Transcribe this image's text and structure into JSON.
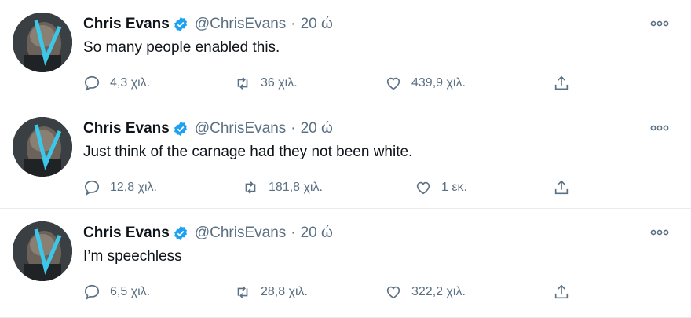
{
  "tweets": [
    {
      "name": "Chris Evans",
      "handle": "@ChrisEvans",
      "separator": "·",
      "time": "20 ώ",
      "text": "So many people enabled this.",
      "replies": "4,3 χιλ.",
      "retweets": "36 χιλ.",
      "likes": "439,9 χιλ."
    },
    {
      "name": "Chris Evans",
      "handle": "@ChrisEvans",
      "separator": "·",
      "time": "20 ώ",
      "text": "Just think of the carnage had they not been white.",
      "replies": "12,8 χιλ.",
      "retweets": "181,8 χιλ.",
      "likes": "1 εκ."
    },
    {
      "name": "Chris Evans",
      "handle": "@ChrisEvans",
      "separator": "·",
      "time": "20 ώ",
      "text": "I’m speechless",
      "replies": "6,5 χιλ.",
      "retweets": "28,8 χιλ.",
      "likes": "322,2 χιλ."
    }
  ],
  "icons": {
    "verified": "verified-badge-icon",
    "more": "more-options-icon",
    "reply": "reply-icon",
    "retweet": "retweet-icon",
    "like": "heart-icon",
    "share": "share-icon"
  },
  "colors": {
    "verified": "#1da1f2",
    "secondary_text": "#5b7083",
    "divider": "#e6ecf0"
  }
}
